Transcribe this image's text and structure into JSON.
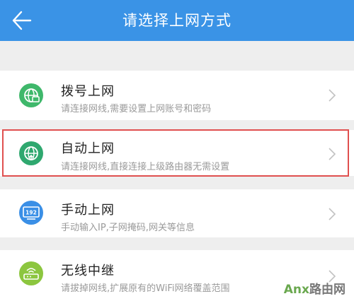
{
  "header": {
    "title": "请选择上网方式",
    "back_icon": "arrow-left-icon",
    "background": "#3a93e6"
  },
  "options": [
    {
      "title": "拨号上网",
      "subtitle": "请连接网线,需要设置上网账号和密码",
      "icon": "globe-dialup-icon",
      "icon_color": "#3fb86b",
      "selected": false
    },
    {
      "title": "自动上网",
      "subtitle": "请连接网线,直接连接上级路由器无需设置",
      "icon": "globe-auto-icon",
      "icon_color": "#2fa86f",
      "selected": true
    },
    {
      "title": "手动上网",
      "subtitle": "手动输入IP,子网掩码,网关等信息",
      "icon": "monitor-192-icon",
      "icon_text": "192",
      "icon_color": "#3a8fe6",
      "selected": false
    },
    {
      "title": "无线中继",
      "subtitle": "请拔掉网线,扩展原有的WiFi网络覆盖范围",
      "icon": "router-wifi-icon",
      "icon_color": "#8cc63f",
      "selected": false
    }
  ],
  "highlight_color": "#e0504f",
  "watermark": {
    "part_a": "Anx",
    "part_b": "路由网"
  }
}
